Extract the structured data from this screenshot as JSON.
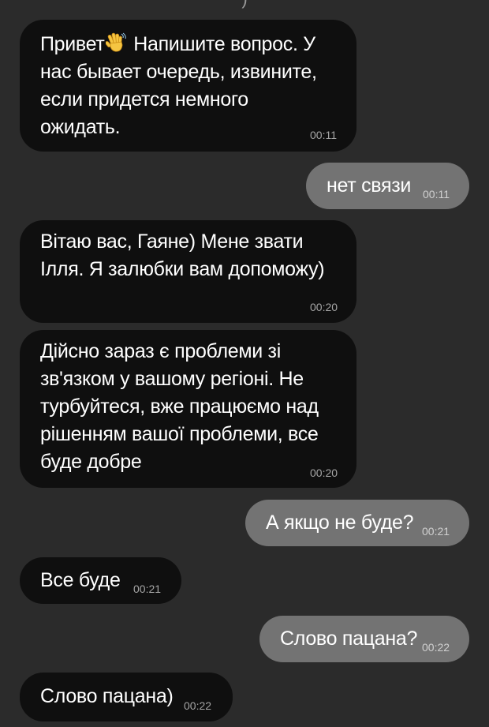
{
  "header": {
    "fragment": ")"
  },
  "messages": [
    {
      "direction": "incoming",
      "text_before_emoji": "Привет",
      "emoji": "waving-hand-icon",
      "text_after_emoji": " Напишите вопрос. У\nнас бывает очередь, извините,\nесли придется немного\nожидать.",
      "time": "00:11"
    },
    {
      "direction": "outgoing",
      "text": "нет связи",
      "time": "00:11"
    },
    {
      "direction": "incoming",
      "text": "Вітаю вас, Гаяне) Мене звати\nІлля. Я залюбки вам допоможу)",
      "time": "00:20"
    },
    {
      "direction": "incoming",
      "text": "Дійсно зараз є проблеми зі\nзв'язком у вашому регіоні. Не\nтурбуйтеся, вже працюємо над\nрішенням вашої проблеми, все\nбуде добре",
      "time": "00:20"
    },
    {
      "direction": "outgoing",
      "text": "А якщо не буде?",
      "time": "00:21"
    },
    {
      "direction": "incoming",
      "text": "Все буде",
      "time": "00:21"
    },
    {
      "direction": "outgoing",
      "text": "Слово пацана?",
      "time": "00:22"
    },
    {
      "direction": "incoming",
      "text": "Слово пацана)",
      "time": "00:22"
    }
  ],
  "colors": {
    "background": "#2b2b2b",
    "incoming_bubble": "#0f0f0f",
    "outgoing_bubble": "#737373",
    "timestamp": "#a5a5a5",
    "emoji_yellow": "#f5c542"
  }
}
